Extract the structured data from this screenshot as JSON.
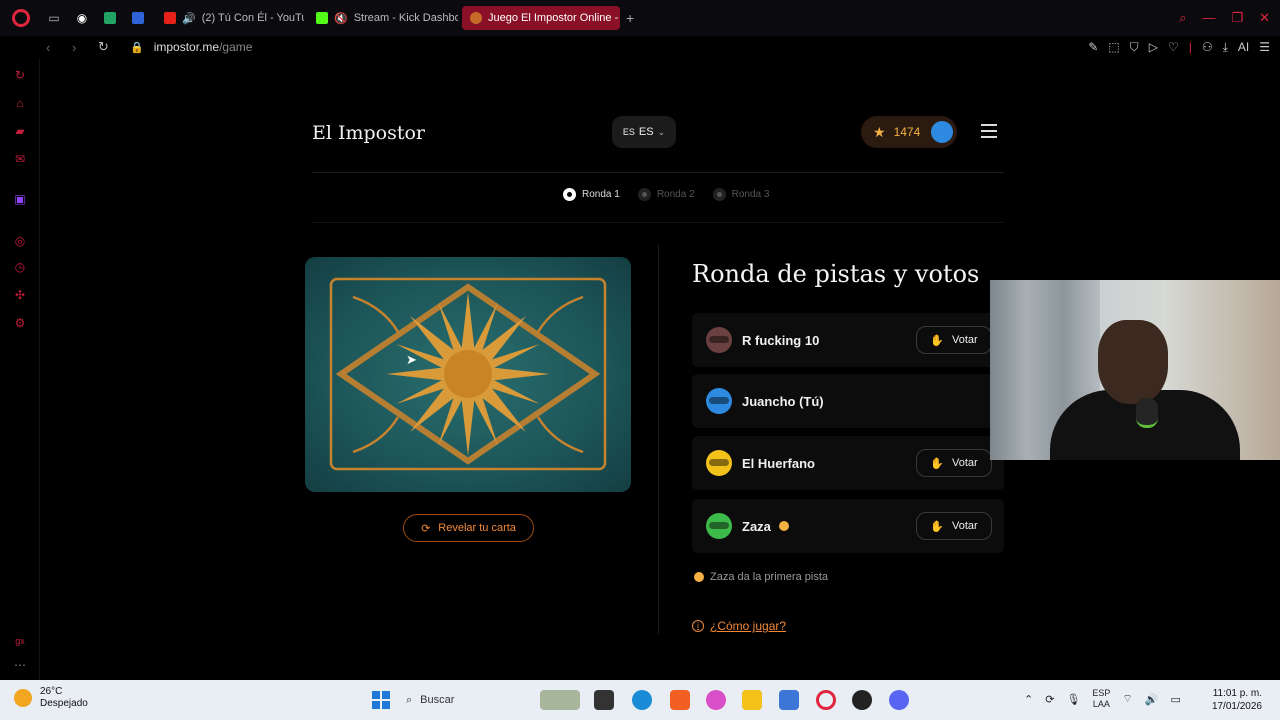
{
  "browser": {
    "tabs": [
      {
        "label": "(2) Tú Con Él - YouTub",
        "fav_color": "#e62117",
        "active": false
      },
      {
        "label": "Stream - Kick Dashbo",
        "fav_color": "#53fc18",
        "active": false
      },
      {
        "label": "Juego El Impostor Online -",
        "fav_color": "#c66a2a",
        "active": true
      }
    ],
    "new_tab_label": "+",
    "url_host": "impostor.me",
    "url_path": "/game",
    "ai_label": "AI"
  },
  "site": {
    "title": "El Impostor",
    "lang_small": "ES",
    "lang_code": "ES",
    "points": "1474"
  },
  "rounds": [
    {
      "label": "Ronda 1",
      "active": true
    },
    {
      "label": "Ronda 2",
      "active": false
    },
    {
      "label": "Ronda 3",
      "active": false
    }
  ],
  "card": {
    "reveal_label": "Revelar tu carta"
  },
  "section_title": "Ronda de pistas y votos",
  "players": [
    {
      "name": "R fucking 10",
      "avatar_color": "#6b4040",
      "vote_label": "Votar",
      "has_vote": true,
      "is_turn": false
    },
    {
      "name": "Juancho (Tú)",
      "avatar_color": "#2d8ae0",
      "vote_label": "",
      "has_vote": false,
      "is_turn": false
    },
    {
      "name": "El Huerfano",
      "avatar_color": "#f2c21b",
      "vote_label": "Votar",
      "has_vote": true,
      "is_turn": false
    },
    {
      "name": "Zaza",
      "avatar_color": "#3dbb4a",
      "vote_label": "Votar",
      "has_vote": true,
      "is_turn": true
    }
  ],
  "hint_text": "Zaza da la primera pista",
  "howto_label": "¿Cómo jugar?",
  "taskbar": {
    "temp": "26°C",
    "weather": "Despejado",
    "search_placeholder": "Buscar",
    "lang_line1": "ESP",
    "lang_line2": "LAA",
    "time": "11:01 p. m.",
    "date": "17/01/2026"
  },
  "colors": {
    "accent": "#f08a3a",
    "brand_red": "#e0263f",
    "gold": "#f5b142"
  }
}
